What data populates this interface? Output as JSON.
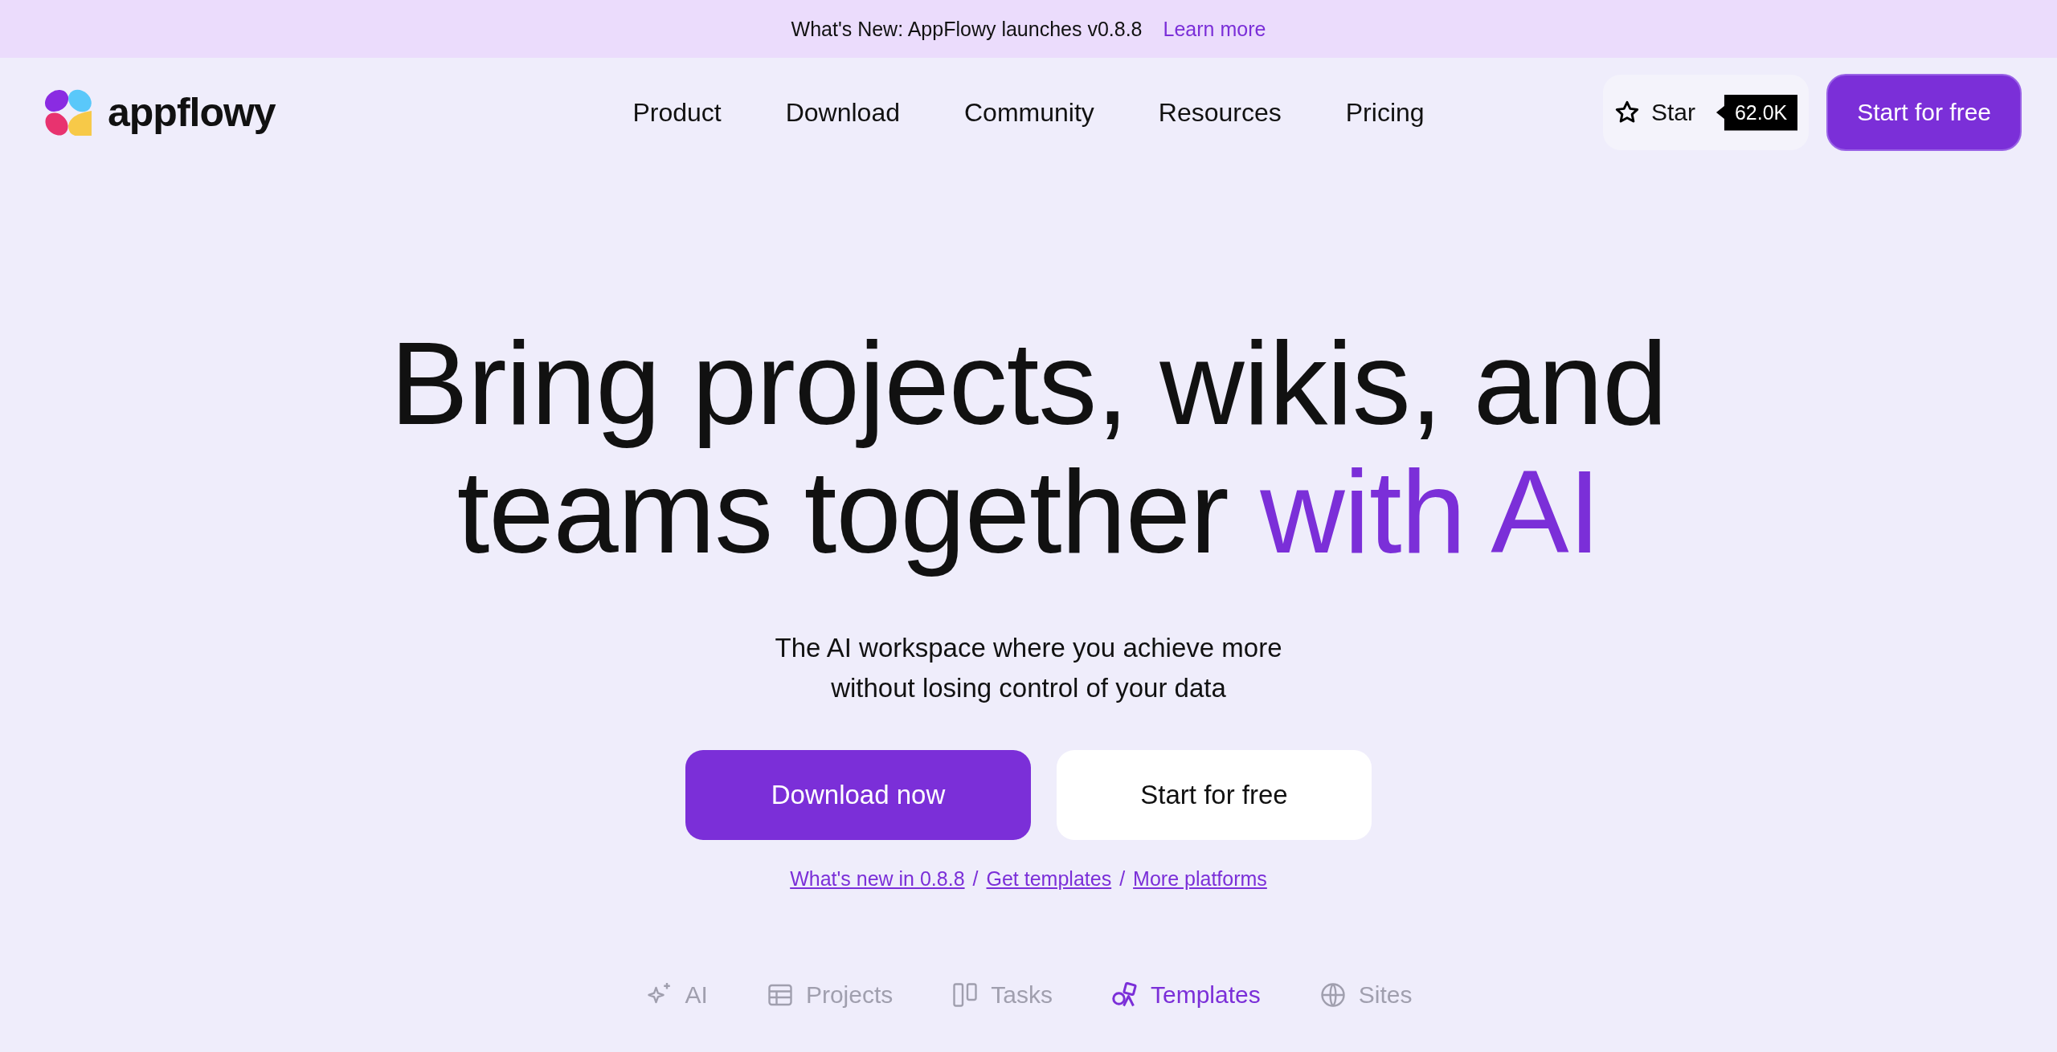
{
  "announcement": {
    "text": "What's New: AppFlowy launches v0.8.8",
    "link": "Learn more"
  },
  "nav": {
    "logo": "appflowy",
    "links": [
      "Product",
      "Download",
      "Community",
      "Resources",
      "Pricing"
    ],
    "star": {
      "label": "Star",
      "count": "62.0K"
    },
    "cta": "Start for free"
  },
  "hero": {
    "title_lines": [
      "Bring projects, wikis, and",
      "teams together"
    ],
    "title_highlight": "with AI",
    "subtitle_lines": [
      "The AI workspace where you achieve more",
      "without losing control of your data"
    ],
    "primary_button": "Download now",
    "secondary_button": "Start for free",
    "links": [
      {
        "text": "What's new in 0.8.8"
      },
      {
        "text": "Get templates"
      },
      {
        "text": "More platforms"
      }
    ],
    "separator": "/"
  },
  "feature_tabs": [
    {
      "kind": "ai",
      "label": "AI",
      "selected": false
    },
    {
      "kind": "projects",
      "label": "Projects",
      "selected": false
    },
    {
      "kind": "tasks",
      "label": "Tasks",
      "selected": false
    },
    {
      "kind": "templates",
      "label": "Templates",
      "selected": true
    },
    {
      "kind": "sites",
      "label": "Sites",
      "selected": false
    }
  ]
}
